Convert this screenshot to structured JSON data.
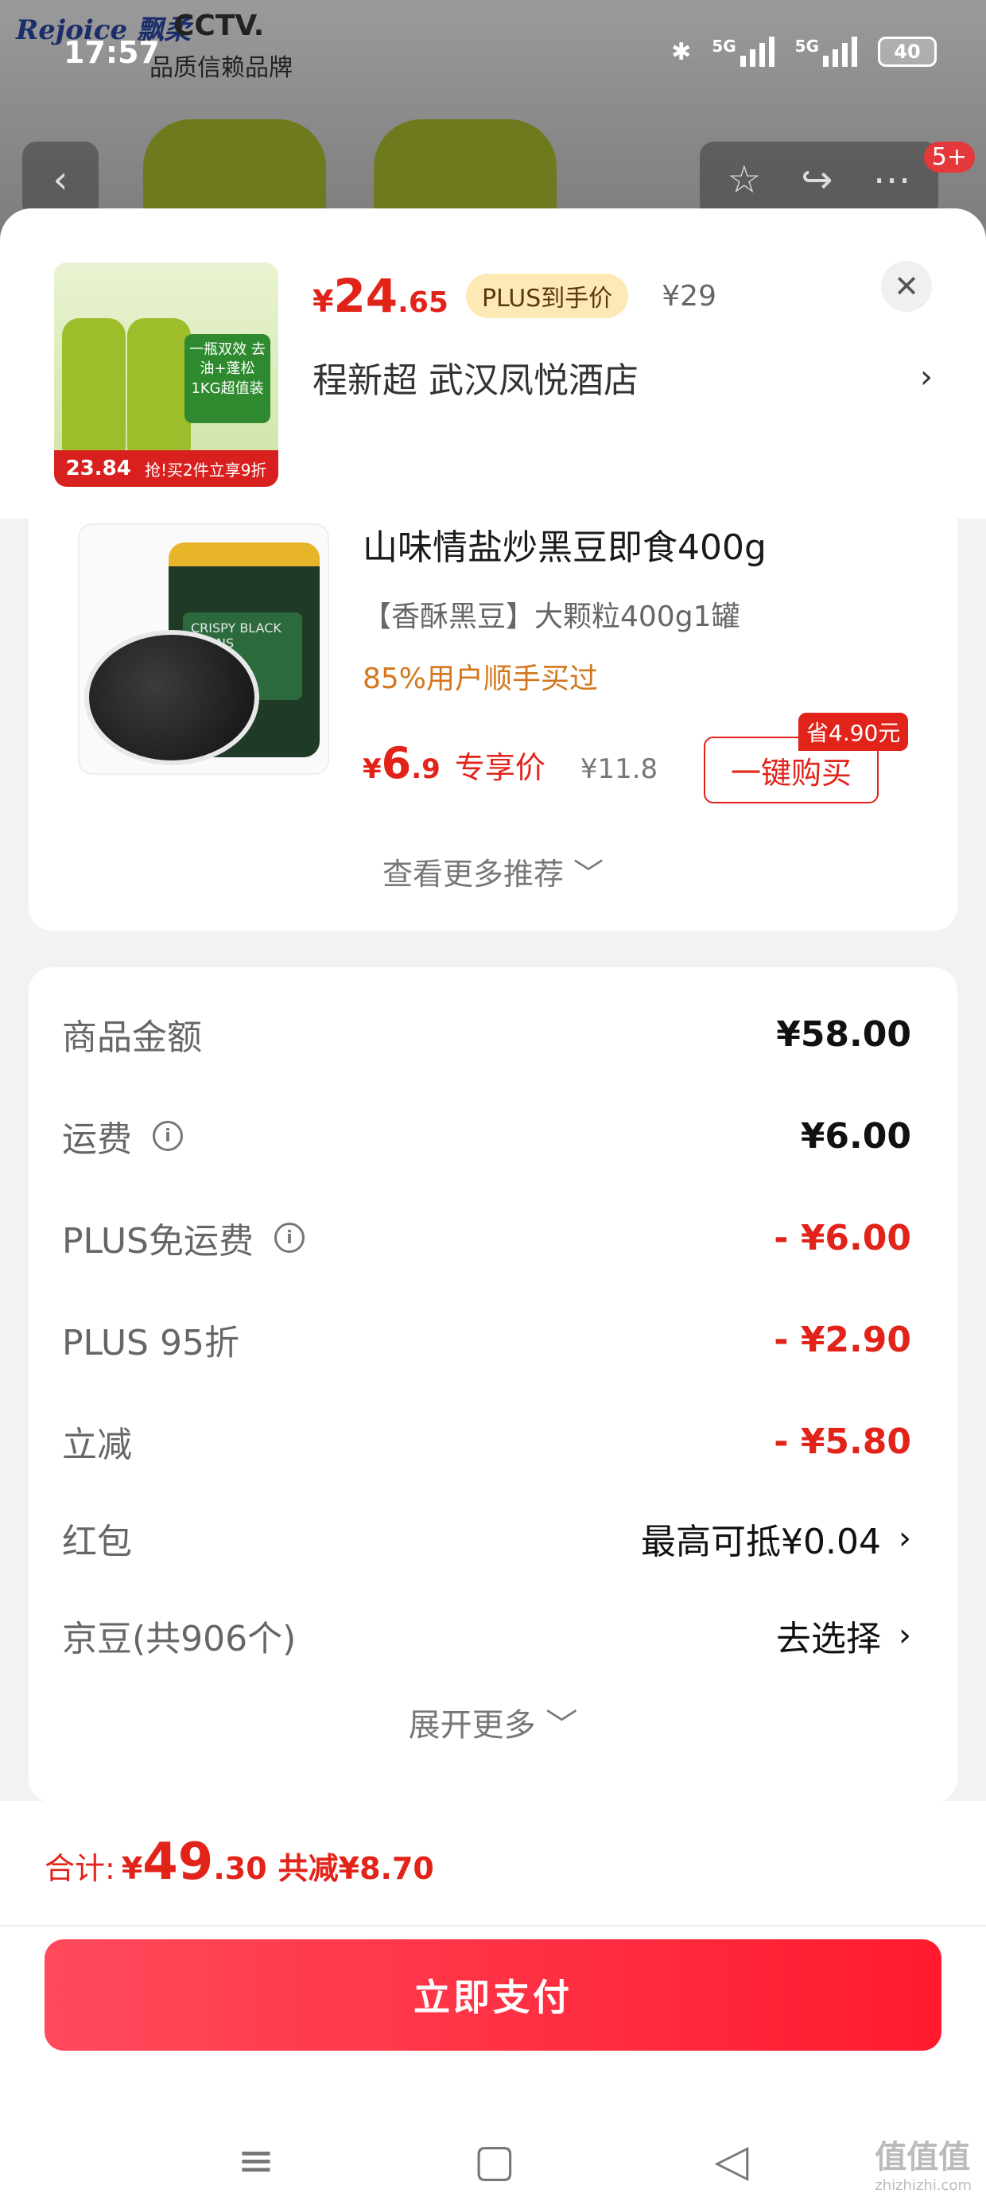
{
  "background": {
    "brand": "Rejoice 飘柔",
    "cctv": "CCTV.",
    "tagline": "品质信赖品牌",
    "cart_badge": "5+"
  },
  "status_bar": {
    "time": "17:57",
    "network1": "5G",
    "network2": "5G",
    "battery": "40"
  },
  "product": {
    "price_currency": "¥",
    "price_int": "24",
    "price_dec": ".65",
    "plus_tag": "PLUS到手价",
    "original_price": "¥29",
    "address": "程新超  武汉凤悦酒店",
    "thumb_promo": "一瓶双效 去油+蓬松 1KG超值装",
    "thumb_price": "23.84",
    "thumb_footer": "抢!买2件立享9折"
  },
  "recommendation": {
    "title": "山味情盐炒黑豆即食400g",
    "spec": "【香酥黑豆】大颗粒400g1罐",
    "social_proof": "85%用户顺手买过",
    "price_currency": "¥",
    "price_int": "6",
    "price_dec": ".9",
    "price_label": "专享价",
    "original_price": "¥11.8",
    "save_tag": "省4.90元",
    "buy_label": "一键购买",
    "jar_label": "CRISPY BLACK BEANS",
    "more_label": "查看更多推荐 ﹀"
  },
  "fees": {
    "rows": [
      {
        "label": "商品金额",
        "value": "¥58.00"
      },
      {
        "label": "运费",
        "value": "¥6.00"
      },
      {
        "label": "PLUS免运费",
        "value": "- ¥6.00"
      },
      {
        "label": "PLUS 95折",
        "value": "- ¥2.90"
      },
      {
        "label": "立减",
        "value": "- ¥5.80"
      },
      {
        "label": "红包",
        "value": "最高可抵¥0.04"
      },
      {
        "label": "京豆(共906个)",
        "value": "去选择"
      }
    ],
    "expand_label": "展开更多 ﹀"
  },
  "total": {
    "label": "合计:",
    "currency": "¥",
    "amount_int": "49",
    "amount_dec": ".30",
    "saved": "共减¥8.70"
  },
  "pay_button": "立即支付",
  "watermark": {
    "main": "值值值",
    "sub": "zhizhizhi.com"
  }
}
